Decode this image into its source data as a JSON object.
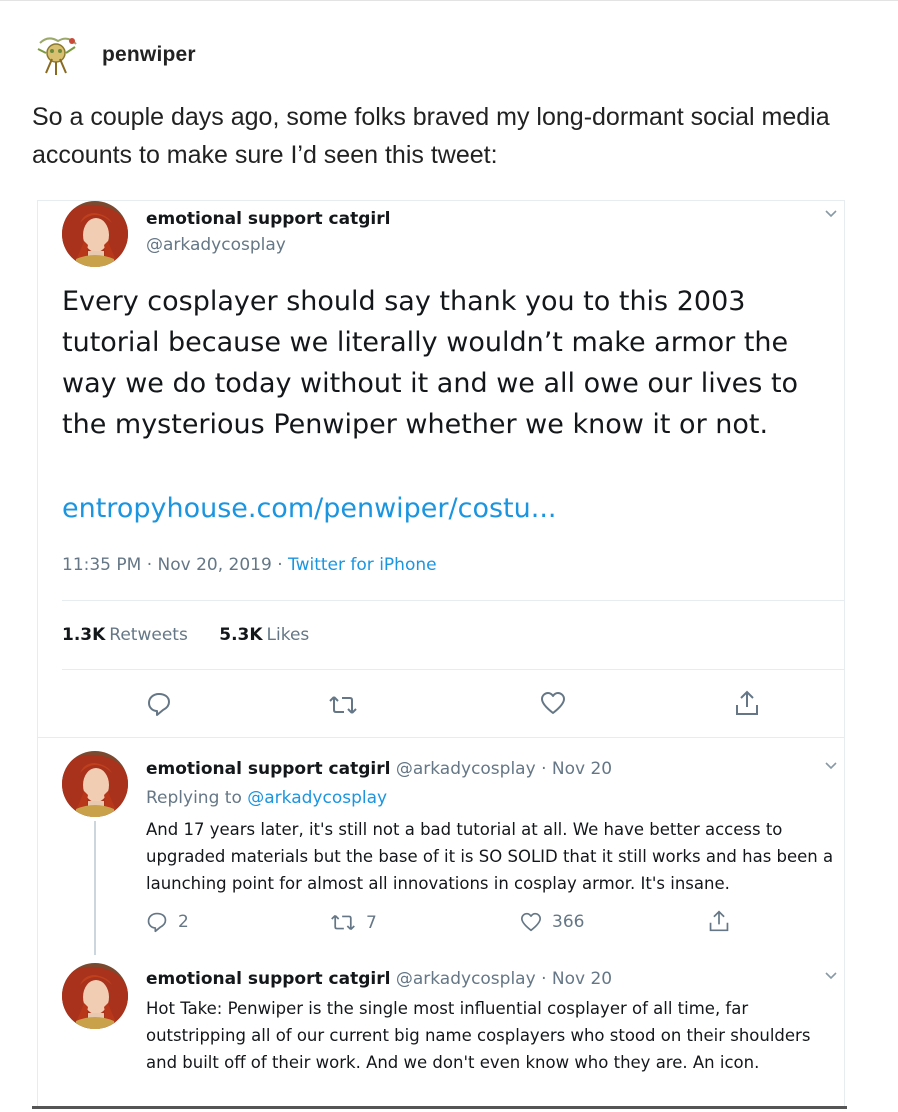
{
  "post": {
    "username": "penwiper",
    "avatar_icon": "penwiper-avatar-icon",
    "text": "So a couple days ago, some folks braved my long-dormant social media accounts to make sure I’d seen this tweet:"
  },
  "main_tweet": {
    "name": "emotional support catgirl",
    "handle": "@arkadycosplay",
    "text": "Every cosplayer should say thank you to this 2003 tutorial because we literally wouldn’t make armor the way we do today without it and we all owe our lives to the mysterious Penwiper whether we know it or not.",
    "link": "entropyhouse.com/penwiper/costu...",
    "time": "11:35 PM · Nov 20, 2019 · ",
    "source": "Twitter for iPhone",
    "retweets_count": "1.3K",
    "retweets_label": "Retweets",
    "likes_count": "5.3K",
    "likes_label": "Likes",
    "actions": [
      "reply-icon",
      "retweet-icon",
      "like-icon",
      "share-icon"
    ]
  },
  "replies": [
    {
      "name": "emotional support catgirl",
      "meta": " @arkadycosplay · Nov 20",
      "replying_label": "Replying to ",
      "replying_handle": "@arkadycosplay",
      "text": "And 17 years later, it's still not a bad tutorial at all. We have better access to upgraded materials but the base of it is SO SOLID that it still works and has been a launching point for almost all innovations in cosplay armor. It's insane.",
      "reply_count": "2",
      "retweet_count": "7",
      "like_count": "366"
    },
    {
      "name": "emotional support catgirl",
      "meta": " @arkadycosplay · Nov 20",
      "text": "Hot Take: Penwiper is the single most influential cosplayer of all time, far outstripping all of our current big name cosplayers who stood on their shoulders and built off of their work. And we don't even know who they are. An icon."
    }
  ],
  "colors": {
    "link_blue": "#1b95e0",
    "muted_gray": "#657786",
    "text_dark": "#14171a",
    "divider": "#e6ecf0"
  }
}
